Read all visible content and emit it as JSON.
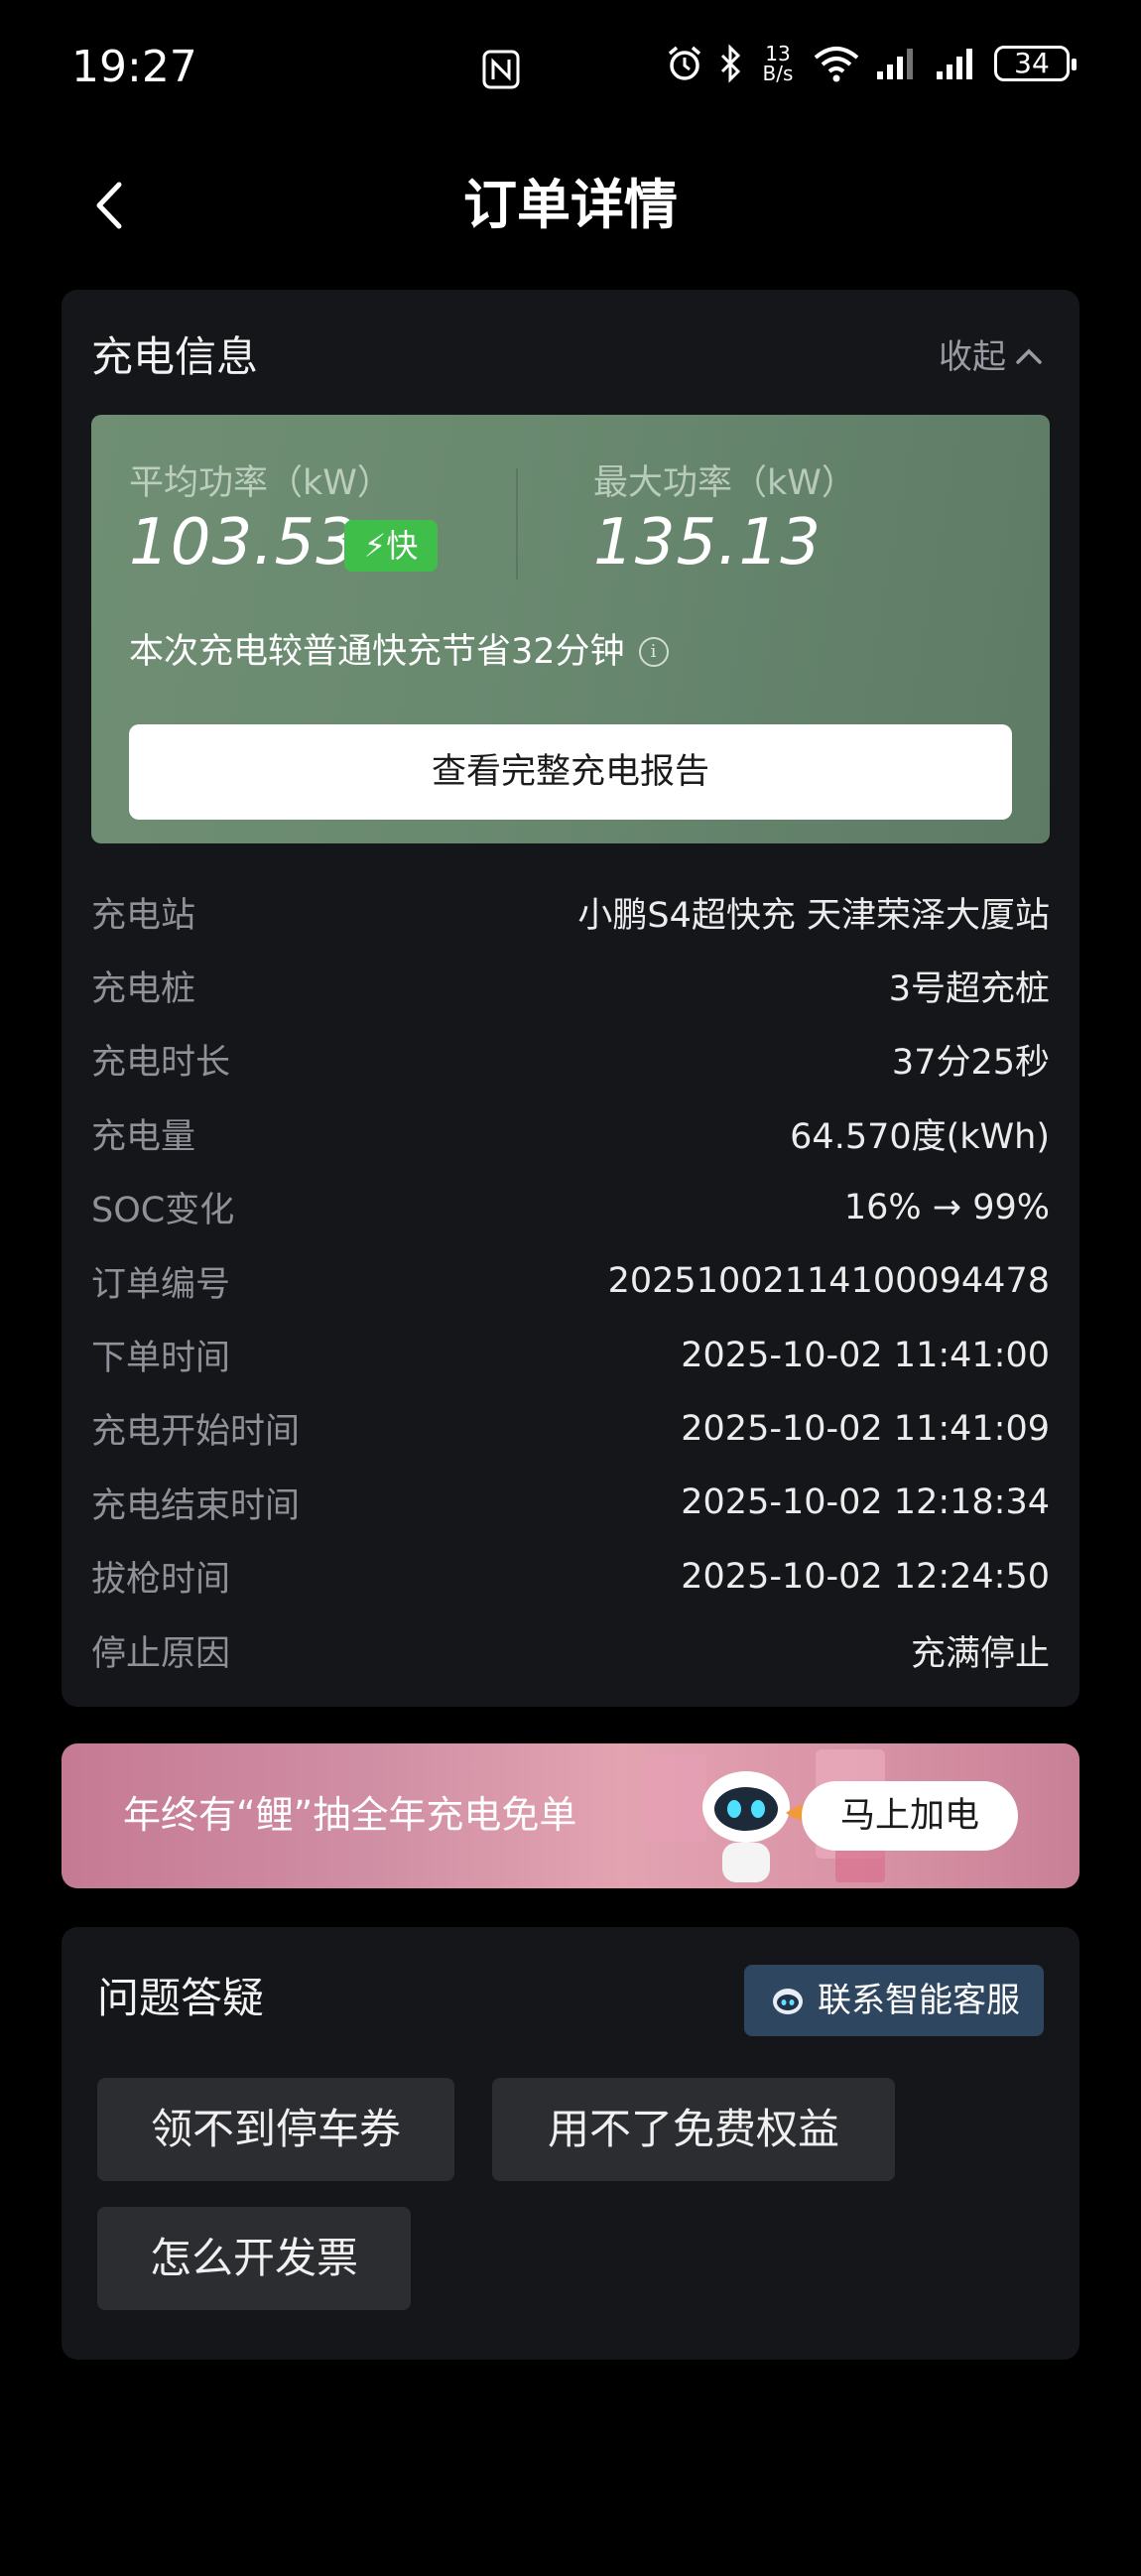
{
  "status_bar": {
    "time": "19:27",
    "net_speed_value": "13",
    "net_speed_unit": "B/s",
    "battery": "34",
    "icons": [
      "nfc-icon",
      "alarm-icon",
      "bluetooth-icon",
      "wifi-icon",
      "signal-icon",
      "signal-icon",
      "battery-icon"
    ]
  },
  "header": {
    "title": "订单详情",
    "back_icon": "chevron-left-icon"
  },
  "charge_info": {
    "title": "充电信息",
    "collapse_label": "收起",
    "avg_power_label": "平均功率（kW）",
    "avg_power_value": "103.53",
    "fast_badge": "⚡快",
    "max_power_label": "最大功率（kW）",
    "max_power_value": "135.13",
    "saving_text": "本次充电较普通快充节省32分钟",
    "report_button": "查看完整充电报告",
    "rows": [
      {
        "label": "充电站",
        "value": "小鹏S4超快充 天津荣泽大厦站"
      },
      {
        "label": "充电桩",
        "value": "3号超充桩"
      },
      {
        "label": "充电时长",
        "value": "37分25秒"
      },
      {
        "label": "充电量",
        "value": "64.570度(kWh)"
      },
      {
        "label": "SOC变化",
        "value": "16% → 99%"
      },
      {
        "label": "订单编号",
        "value": "2025100211410009​4478"
      },
      {
        "label": "下单时间",
        "value": "2025-10-02 11:41:00"
      },
      {
        "label": "充电开始时间",
        "value": "2025-10-02 11:41:09"
      },
      {
        "label": "充电结束时间",
        "value": "2025-10-02 12:18:34"
      },
      {
        "label": "拔枪时间",
        "value": "2025-10-02 12:24:50"
      },
      {
        "label": "停止原因",
        "value": "充满停止"
      }
    ]
  },
  "banner": {
    "text": "年终有“鲤”抽全年充电免单",
    "button": "马上加电"
  },
  "faq": {
    "title": "问题答疑",
    "cs_button": "联系智能客服",
    "chips": [
      "领不到停车券",
      "用不了免费权益",
      "怎么开发票"
    ]
  },
  "colors": {
    "background": "#000000",
    "card": "#15161a",
    "power_panel": "#6a8a70",
    "fast_badge": "#3fbf4a",
    "cs_button": "#2f4660",
    "chip": "#2c2d31"
  }
}
